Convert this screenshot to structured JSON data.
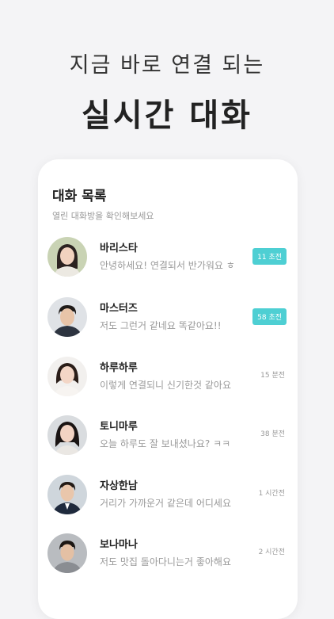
{
  "headline": {
    "subtitle": "지금 바로 연결 되는",
    "title": "실시간 대화"
  },
  "chat_list": {
    "title": "대화 목록",
    "subtitle": "열린 대화방을 확인해보세요",
    "items": [
      {
        "name": "바리스타",
        "preview": "안녕하세요! 연결되서 반가워요 ㅎ",
        "time": "11 초전",
        "highlight": true
      },
      {
        "name": "마스터즈",
        "preview": "저도 그런거 같네요 똑같아요!!",
        "time": "58 초전",
        "highlight": true
      },
      {
        "name": "하루하루",
        "preview": "이렇게 연결되니 신기한것 같아요",
        "time": "15 분전",
        "highlight": false
      },
      {
        "name": "토니마루",
        "preview": "오늘 하루도 잘 보내셨나요? ㅋㅋ",
        "time": "38 분전",
        "highlight": false
      },
      {
        "name": "자상한남",
        "preview": "거리가 가까운거 같은데 어디세요",
        "time": "1 시간전",
        "highlight": false
      },
      {
        "name": "보나마나",
        "preview": "저도 맛집 돌아다니는거 좋아해요",
        "time": "2 시간전",
        "highlight": false
      }
    ]
  },
  "colors": {
    "accent": "#4ecfd3",
    "background": "#f4f4f6"
  }
}
